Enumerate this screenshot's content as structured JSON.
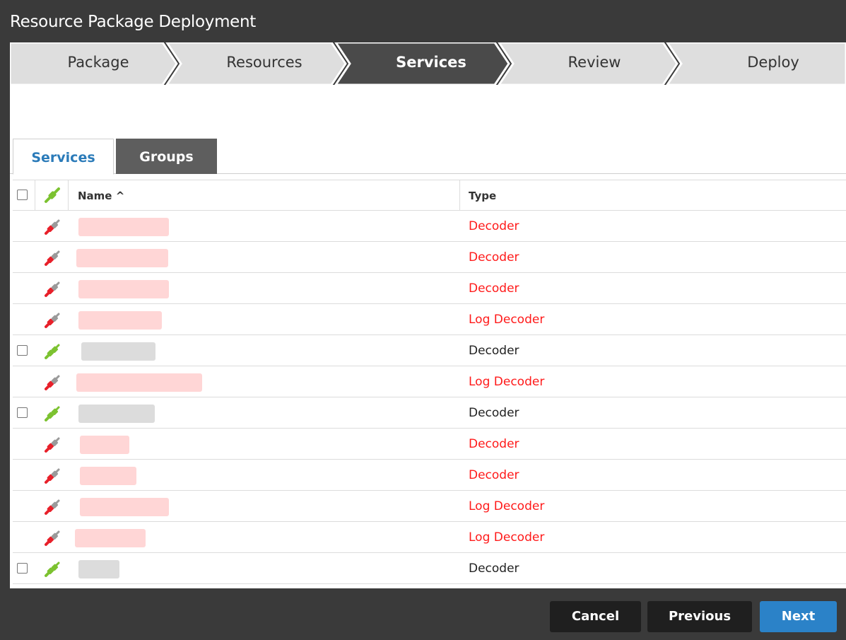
{
  "window": {
    "title": "Resource Package Deployment"
  },
  "wizard": {
    "steps": [
      {
        "label": "Package",
        "active": false
      },
      {
        "label": "Resources",
        "active": false
      },
      {
        "label": "Services",
        "active": true
      },
      {
        "label": "Review",
        "active": false
      },
      {
        "label": "Deploy",
        "active": false
      }
    ]
  },
  "tabs": [
    {
      "label": "Services",
      "selected": true
    },
    {
      "label": "Groups",
      "selected": false
    }
  ],
  "grid": {
    "columns": {
      "name": "Name ^",
      "type": "Type"
    },
    "rows": [
      {
        "type": "Decoder",
        "status": "offline"
      },
      {
        "type": "Decoder",
        "status": "offline"
      },
      {
        "type": "Decoder",
        "status": "offline"
      },
      {
        "type": "Log Decoder",
        "status": "offline"
      },
      {
        "type": "Decoder",
        "status": "online"
      },
      {
        "type": "Log Decoder",
        "status": "offline"
      },
      {
        "type": "Decoder",
        "status": "online"
      },
      {
        "type": "Decoder",
        "status": "offline"
      },
      {
        "type": "Decoder",
        "status": "offline"
      },
      {
        "type": "Log Decoder",
        "status": "offline"
      },
      {
        "type": "Log Decoder",
        "status": "offline"
      },
      {
        "type": "Decoder",
        "status": "online"
      }
    ]
  },
  "footer": {
    "cancel": "Cancel",
    "previous": "Previous",
    "next": "Next"
  },
  "colors": {
    "accent": "#2b82c8",
    "offline_text": "#ff1a1a",
    "online_plug": "#7cc230",
    "offline_plug": "#e8202a"
  }
}
